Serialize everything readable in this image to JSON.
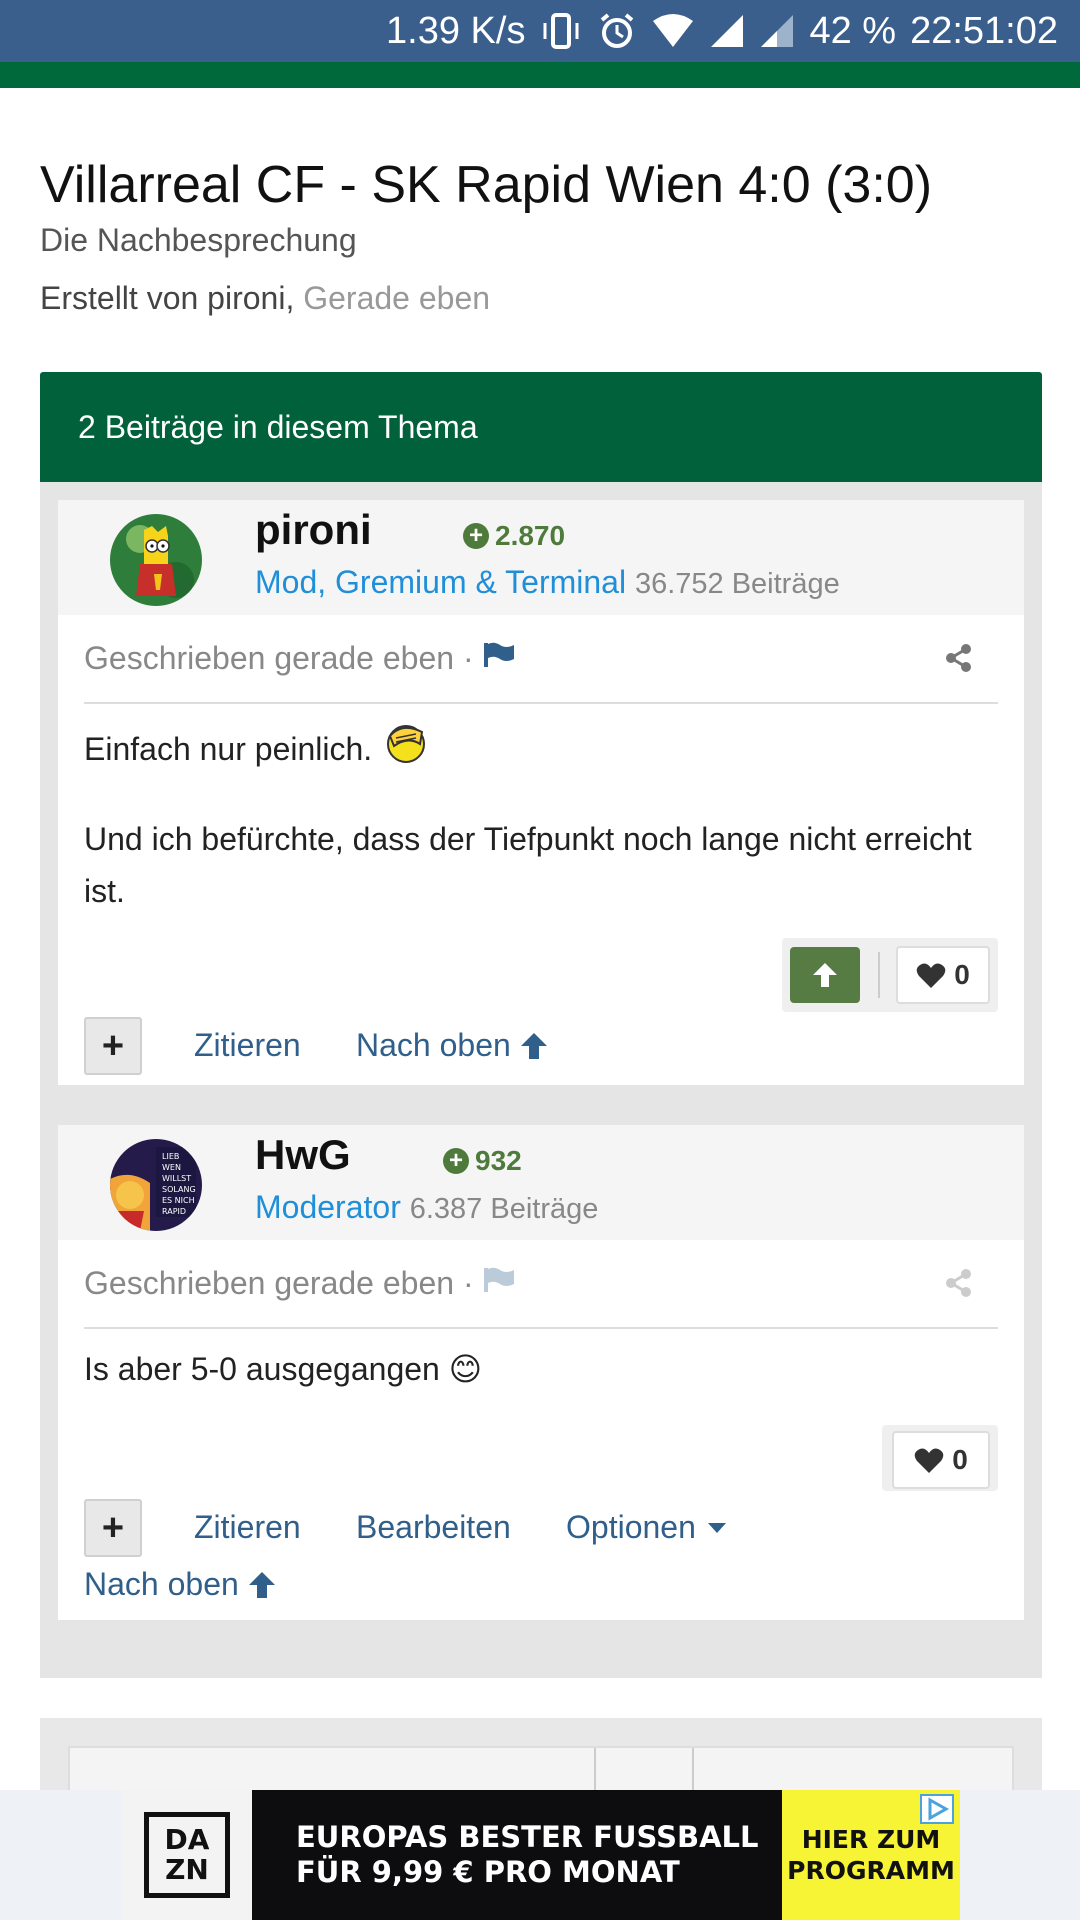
{
  "status_bar": {
    "speed": "1.39 K/s",
    "battery": "42 %",
    "time": "22:51:02",
    "icons": [
      "vibrate-icon",
      "alarm-icon",
      "wifi-icon",
      "signal-icon",
      "signal-icon-2"
    ]
  },
  "topic": {
    "title": "Villarreal CF - SK Rapid Wien 4:0 (3:0)",
    "subtitle": "Die Nachbesprechung",
    "created_by": "Erstellt von pironi,",
    "created_time": "Gerade eben",
    "post_count": "2 Beiträge in diesem Thema"
  },
  "posts": [
    {
      "author": "pironi",
      "reputation": "2.870",
      "role": "Mod, Gremium & Terminal",
      "post_count": "36.752 Beiträge",
      "meta": "Geschrieben gerade eben ·",
      "text_1": "Einfach nur peinlich.",
      "text_2": "Und ich befürchte, dass der Tiefpunkt noch lange nicht erreicht ist.",
      "likes": "0",
      "plus": "+",
      "quote": "Zitieren",
      "top": "Nach oben"
    },
    {
      "author": "HwG",
      "reputation": "932",
      "role": "Moderator",
      "post_count": "6.387 Beiträge",
      "meta": "Geschrieben gerade eben ·",
      "text_1": "Is aber 5-0 ausgegangen 😊",
      "likes": "0",
      "plus": "+",
      "quote": "Zitieren",
      "edit": "Bearbeiten",
      "options": "Optionen",
      "top": "Nach oben"
    }
  ],
  "ad": {
    "logo": "DAZN",
    "headline_1": "EUROPAS BESTER FUSSBALL",
    "headline_2": "FÜR 9,99 € PRO MONAT",
    "cta_1": "HIER ZUM",
    "cta_2": "PROGRAMM"
  },
  "colors": {
    "status_bar": "#3a5f8c",
    "brand_green": "#00613a",
    "link_blue": "#2f5f8a",
    "role_blue": "#1e8fd8",
    "rep_green": "#4e7a3b"
  }
}
